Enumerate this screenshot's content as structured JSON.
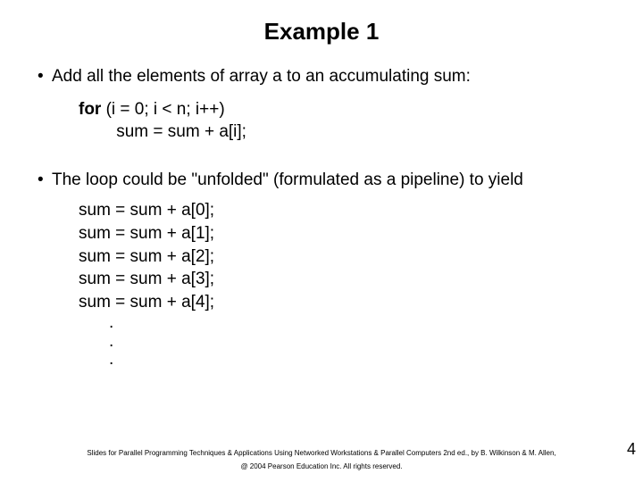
{
  "title": "Example 1",
  "bullet1": "Add all the elements of array a to an accumulating sum:",
  "code_for_prefix": "for ",
  "code_for_rest": "(i = 0; i < n; i++)",
  "code_body": "        sum = sum + a[i];",
  "bullet2": "The loop could be \"unfolded\"  (formulated as a pipeline) to yield",
  "unfolded": [
    "sum = sum + a[0];",
    "sum = sum + a[1];",
    "sum = sum + a[2];",
    "sum = sum + a[3];",
    "sum = sum + a[4];"
  ],
  "dots": [
    ".",
    ".",
    "."
  ],
  "footer1": "Slides for Parallel Programming Techniques & Applications Using Networked Workstations & Parallel Computers 2nd ed., by B. Wilkinson & M. Allen,",
  "footer2": "@ 2004 Pearson Education Inc. All rights reserved.",
  "pagenum": "4",
  "bullet_glyph": "•"
}
